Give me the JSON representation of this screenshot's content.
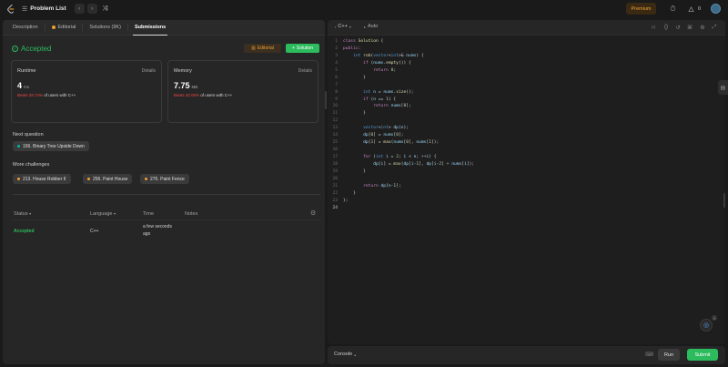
{
  "topbar": {
    "problem_list": "Problem List",
    "premium": "Premium",
    "streak_count": "0"
  },
  "tabs": [
    {
      "label": "Description",
      "active": false
    },
    {
      "label": "Editorial",
      "active": false
    },
    {
      "label": "Solutions (9K)",
      "active": false
    },
    {
      "label": "Submissions",
      "active": true
    }
  ],
  "result": {
    "status": "Accepted",
    "editorial_label": "Editorial",
    "solution_label": "Solution"
  },
  "runtime": {
    "title": "Runtime",
    "details": "Details",
    "value": "4",
    "unit": "ms",
    "beats_pct": "Beats 29.74%",
    "beats_suffix": "of users with C++"
  },
  "memory": {
    "title": "Memory",
    "details": "Details",
    "value": "7.75",
    "unit": "MB",
    "beats_pct": "Beats 42.05%",
    "beats_suffix": "of users with C++"
  },
  "next_question": {
    "label": "Next question",
    "item": "156. Binary Tree Upside Down"
  },
  "more_challenges": {
    "label": "More challenges",
    "items": [
      "213. House Robber II",
      "256. Paint House",
      "276. Paint Fence"
    ]
  },
  "table": {
    "headers": [
      "Status",
      "Language",
      "Time",
      "Notes"
    ],
    "rows": [
      {
        "status": "Accepted",
        "language": "C++",
        "time_line1": "a few seconds",
        "time_line2": "ago"
      }
    ]
  },
  "editor": {
    "language": "C++",
    "mode": "Auto",
    "lines": [
      "class Solution {",
      "public:",
      "    int rob(vector<int>& nums) {",
      "        if (nums.empty()) {",
      "            return 0;",
      "        }",
      "",
      "        int n = nums.size();",
      "        if (n == 1) {",
      "            return nums[0];",
      "        }",
      "",
      "        vector<int> dp(n);",
      "        dp[0] = nums[0];",
      "        dp[1] = max(nums[0], nums[1]);",
      "",
      "        for (int i = 2; i < n; ++i) {",
      "            dp[i] = max(dp[i-1], dp[i-2] + nums[i]);",
      "        }",
      "",
      "        return dp[n-1];",
      "    }",
      "};",
      ""
    ]
  },
  "console": {
    "label": "Console",
    "run": "Run",
    "submit": "Submit"
  },
  "colors": {
    "accepted": "#2cbb5d",
    "premium": "#f0a030",
    "beats": "#ef4743",
    "keyword": "#c586c0",
    "type": "#569cd6",
    "number": "#b5cea8",
    "function": "#dcdcaa"
  }
}
